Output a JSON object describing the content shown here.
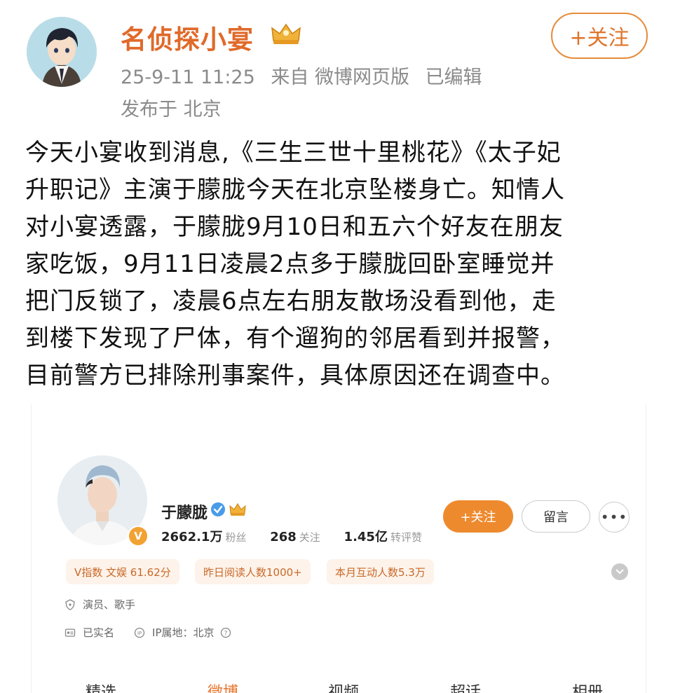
{
  "post": {
    "author_name": "名侦探小宴",
    "timestamp": "25-9-11 11:25",
    "source": "来自 微博网页版",
    "edited": "已编辑",
    "location": "发布于 北京",
    "follow_label": "+关注",
    "text": "今天小宴收到消息,《三生三世十里桃花》《太子妃\n升职记》主演于朦胧今天在北京坠楼身亡。知情人\n对小宴透露，于朦胧9月10日和五六个好友在朋友\n家吃饭，9月11日凌晨2点多于朦胧回卧室睡觉并\n把门反锁了，凌晨6点左右朋友散场没看到他，走\n到楼下发现了尸体，有个遛狗的邻居看到并报警，\n目前警方已排除刑事案件，具体原因还在调查中。"
  },
  "profile": {
    "name": "于朦胧",
    "badge_letter": "V",
    "stats": [
      {
        "value": "2662.1万",
        "label": "粉丝"
      },
      {
        "value": "268",
        "label": "关注"
      },
      {
        "value": "1.45亿",
        "label": "转评赞"
      }
    ],
    "follow_label": "+关注",
    "message_label": "留言",
    "more_label": "•••",
    "tags": [
      "V指数 文娱 61.62分",
      "昨日阅读人数1000+",
      "本月互动人数5.3万"
    ],
    "occupation": "演员、歌手",
    "verified_name": "已实名",
    "ip_location": "IP属地：北京",
    "tabs": [
      "精选",
      "微博",
      "视频",
      "超话",
      "相册"
    ],
    "active_tab": "微博"
  },
  "colors": {
    "accent": "#e0742b",
    "follow_fill": "#ee8a2e",
    "tag_bg": "#fdf3ea",
    "meta_gray": "#8a8a8a"
  }
}
